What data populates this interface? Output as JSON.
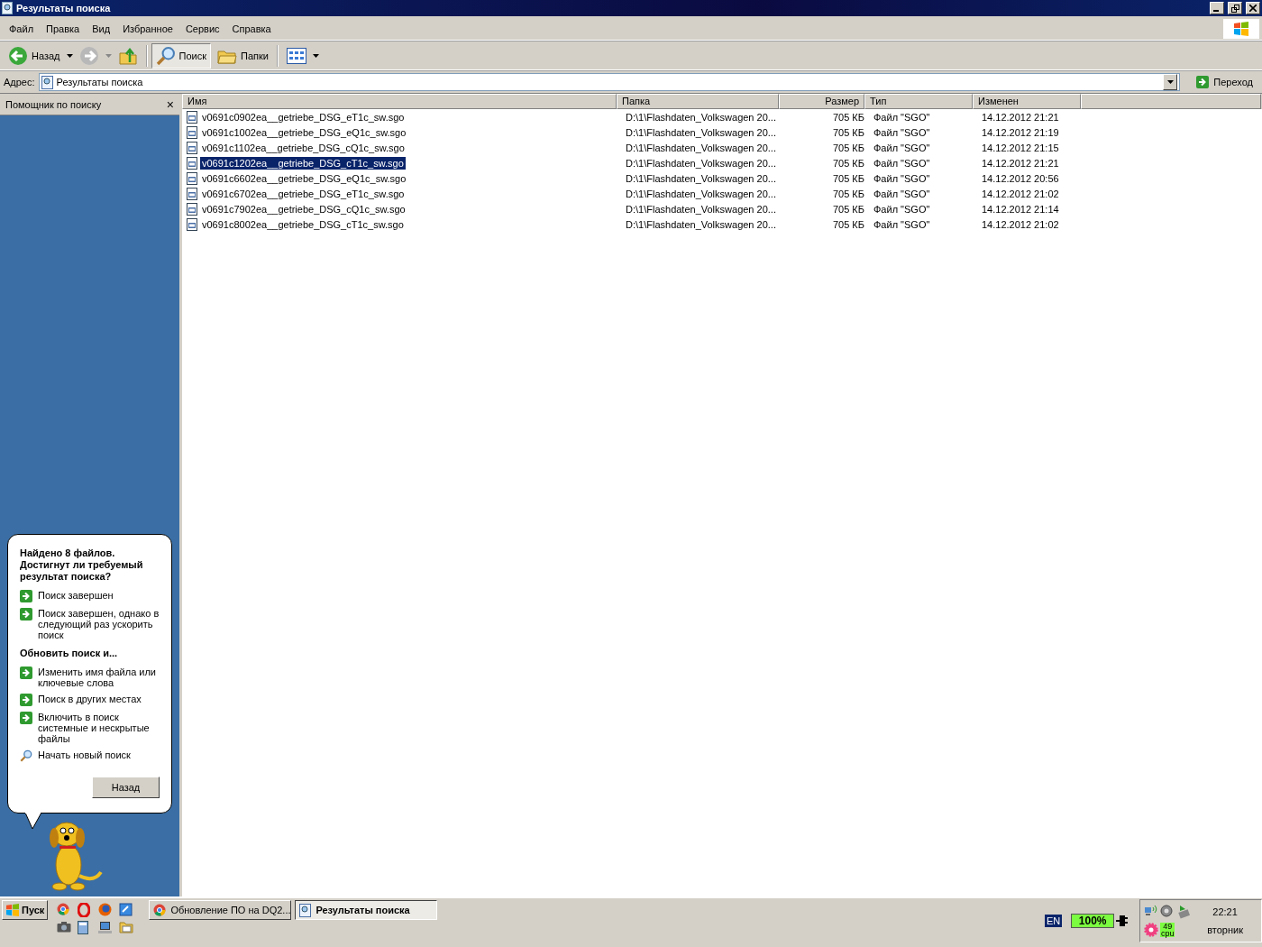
{
  "window": {
    "title": "Результаты поиска"
  },
  "menu": [
    "Файл",
    "Правка",
    "Вид",
    "Избранное",
    "Сервис",
    "Справка"
  ],
  "toolbar": [
    {
      "kind": "back",
      "label": "Назад",
      "selected": false
    },
    {
      "kind": "forward",
      "selected": false
    },
    {
      "kind": "up",
      "selected": false
    },
    {
      "kind": "search",
      "label": "Поиск",
      "selected": true
    },
    {
      "kind": "folders",
      "label": "Папки",
      "selected": false
    },
    {
      "kind": "views",
      "selected": false
    }
  ],
  "address": {
    "label": "Адрес:",
    "value": "Результаты поиска",
    "go": "Переход"
  },
  "search_pane": {
    "title": "Помощник по поиску",
    "close": "×",
    "heading": "Найдено 8 файлов. Достигнут ли требуемый результат поиска?",
    "options": [
      {
        "kind": "arrow",
        "label": "Поиск завершен"
      },
      {
        "kind": "arrow",
        "label": "Поиск завершен, однако в следующий раз ускорить поиск"
      },
      {
        "kind": "section",
        "label": "Обновить поиск и..."
      },
      {
        "kind": "arrow",
        "label": "Изменить имя файла или ключевые слова"
      },
      {
        "kind": "arrow",
        "label": "Поиск в других местах"
      },
      {
        "kind": "arrow",
        "label": "Включить в поиск системные и нескрытые файлы"
      },
      {
        "kind": "search",
        "label": "Начать новый поиск"
      }
    ],
    "button": "Назад"
  },
  "table": {
    "columns": [
      "Имя",
      "Папка",
      "Размер",
      "Тип",
      "Изменен"
    ],
    "rows": [
      {
        "name": "v0691c0902ea__getriebe_DSG_eT1c_sw.sgo",
        "folder": "D:\\1\\Flashdaten_Volkswagen 20...",
        "size": "705 КБ",
        "type": "Файл \"SGO\"",
        "modified": "14.12.2012 21:21",
        "selected": false
      },
      {
        "name": "v0691c1002ea__getriebe_DSG_eQ1c_sw.sgo",
        "folder": "D:\\1\\Flashdaten_Volkswagen 20...",
        "size": "705 КБ",
        "type": "Файл \"SGO\"",
        "modified": "14.12.2012 21:19",
        "selected": false
      },
      {
        "name": "v0691c1102ea__getriebe_DSG_cQ1c_sw.sgo",
        "folder": "D:\\1\\Flashdaten_Volkswagen 20...",
        "size": "705 КБ",
        "type": "Файл \"SGO\"",
        "modified": "14.12.2012 21:15",
        "selected": false
      },
      {
        "name": "v0691c1202ea__getriebe_DSG_cT1c_sw.sgo",
        "folder": "D:\\1\\Flashdaten_Volkswagen 20...",
        "size": "705 КБ",
        "type": "Файл \"SGO\"",
        "modified": "14.12.2012 21:21",
        "selected": true
      },
      {
        "name": "v0691c6602ea__getriebe_DSG_eQ1c_sw.sgo",
        "folder": "D:\\1\\Flashdaten_Volkswagen 20...",
        "size": "705 КБ",
        "type": "Файл \"SGO\"",
        "modified": "14.12.2012 20:56",
        "selected": false
      },
      {
        "name": "v0691c6702ea__getriebe_DSG_eT1c_sw.sgo",
        "folder": "D:\\1\\Flashdaten_Volkswagen 20...",
        "size": "705 КБ",
        "type": "Файл \"SGO\"",
        "modified": "14.12.2012 21:02",
        "selected": false
      },
      {
        "name": "v0691c7902ea__getriebe_DSG_cQ1c_sw.sgo",
        "folder": "D:\\1\\Flashdaten_Volkswagen 20...",
        "size": "705 КБ",
        "type": "Файл \"SGO\"",
        "modified": "14.12.2012 21:14",
        "selected": false
      },
      {
        "name": "v0691c8002ea__getriebe_DSG_cT1c_sw.sgo",
        "folder": "D:\\1\\Flashdaten_Volkswagen 20...",
        "size": "705 КБ",
        "type": "Файл \"SGO\"",
        "modified": "14.12.2012 21:02",
        "selected": false
      }
    ]
  },
  "taskbar": {
    "start": "Пуск",
    "tasks": [
      {
        "kind": "chrome",
        "label": "Обновление ПО на DQ2...",
        "selected": false
      },
      {
        "kind": "search",
        "label": "Результаты поиска",
        "selected": true
      }
    ],
    "language": "EN",
    "battery": "100%",
    "cpu": "49",
    "cpu_label": "cpu",
    "time": "22:21",
    "day": "вторник"
  }
}
